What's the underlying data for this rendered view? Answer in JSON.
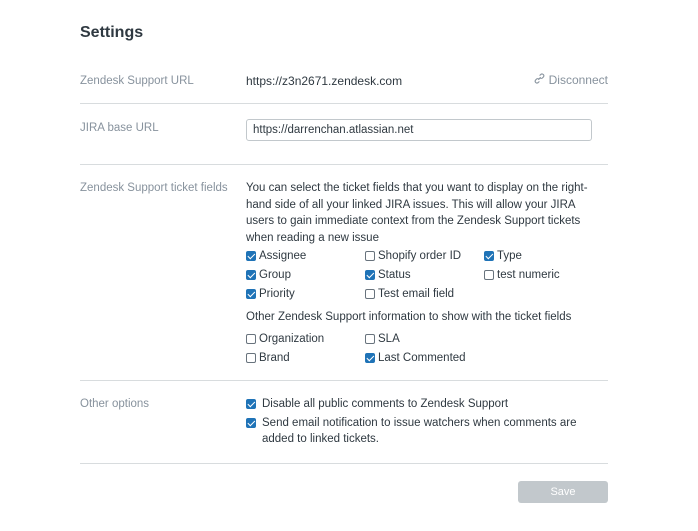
{
  "page": {
    "title": "Settings"
  },
  "zendesk_url": {
    "label": "Zendesk Support URL",
    "value": "https://z3n2671.zendesk.com",
    "disconnect_label": "Disconnect"
  },
  "jira": {
    "label": "JIRA base URL",
    "value": "https://darrenchan.atlassian.net"
  },
  "ticket_fields": {
    "label": "Zendesk Support ticket fields",
    "description": "You can select the ticket fields that you want to display on the right-hand side of all your linked JIRA issues. This will allow your JIRA users to gain immediate context from the Zendesk Support tickets when reading a new issue",
    "fields": [
      {
        "label": "Assignee",
        "checked": true
      },
      {
        "label": "Shopify order ID",
        "checked": false
      },
      {
        "label": "Type",
        "checked": true
      },
      {
        "label": "Group",
        "checked": true
      },
      {
        "label": "Status",
        "checked": true
      },
      {
        "label": "test numeric",
        "checked": false
      },
      {
        "label": "Priority",
        "checked": true
      },
      {
        "label": "Test email field",
        "checked": false
      }
    ],
    "other_heading": "Other Zendesk Support information to show with the ticket fields",
    "other": [
      {
        "label": "Organization",
        "checked": false
      },
      {
        "label": "SLA",
        "checked": false
      },
      {
        "label": "Brand",
        "checked": false
      },
      {
        "label": "Last Commented",
        "checked": true
      }
    ]
  },
  "other_options": {
    "label": "Other options",
    "items": [
      {
        "label": "Disable all public comments to Zendesk Support",
        "checked": true
      },
      {
        "label": "Send email notification to issue watchers when comments are added to linked tickets.",
        "checked": true
      }
    ]
  },
  "save_label": "Save",
  "colors": {
    "accent": "#1f73b7",
    "divider": "#d8dcde",
    "muted": "#87929d",
    "disabled_button": "#c2c8cc"
  }
}
